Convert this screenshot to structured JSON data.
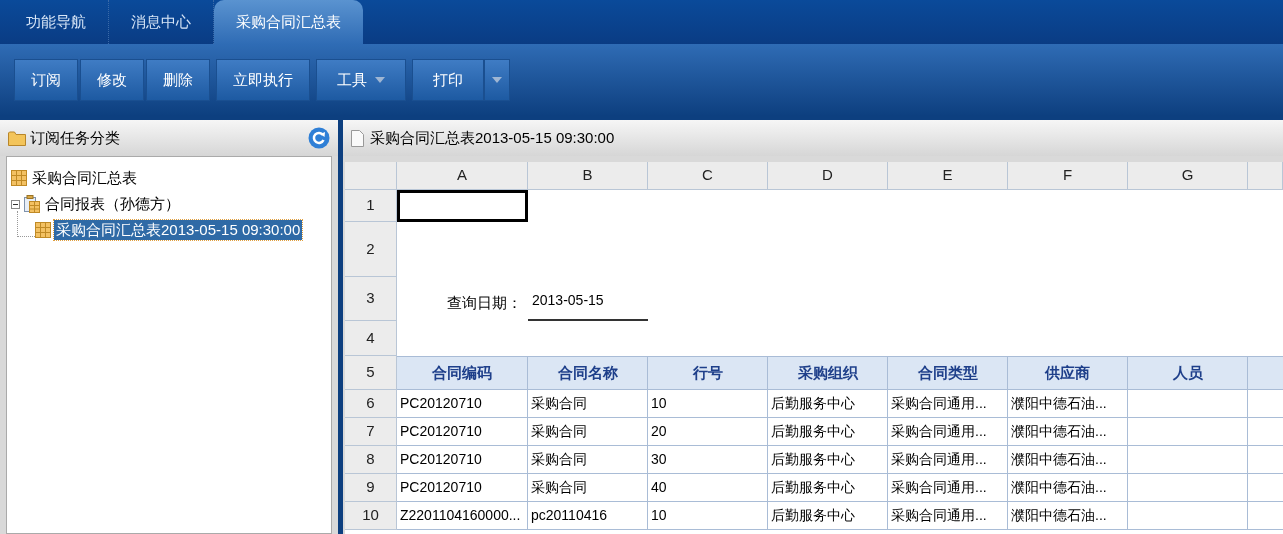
{
  "tabs": [
    {
      "label": "功能导航",
      "selected": false
    },
    {
      "label": "消息中心",
      "selected": false
    },
    {
      "label": "采购合同汇总表",
      "selected": true
    }
  ],
  "toolbar_groups": [
    {
      "buttons": [
        {
          "label": "订阅",
          "kind": "plain"
        },
        {
          "label": "修改",
          "kind": "plain"
        },
        {
          "label": "删除",
          "kind": "plain"
        }
      ]
    },
    {
      "buttons": [
        {
          "label": "立即执行",
          "kind": "plain"
        }
      ]
    },
    {
      "buttons": [
        {
          "label": "工具",
          "kind": "menu"
        }
      ]
    },
    {
      "buttons": [
        {
          "label": "打印",
          "kind": "split"
        }
      ]
    }
  ],
  "left_panel": {
    "title": "订阅任务分类",
    "tree": [
      {
        "label": "采购合同汇总表",
        "kind": "report",
        "selected": false
      },
      {
        "label": "合同报表（孙德方）",
        "kind": "folder",
        "selected": false,
        "expanded": true,
        "children": [
          {
            "label": "采购合同汇总表2013-05-15 09:30:00",
            "kind": "report",
            "selected": true
          }
        ]
      }
    ]
  },
  "sheet": {
    "title": "采购合同汇总表2013-05-15 09:30:00",
    "column_letters": [
      "A",
      "B",
      "C",
      "D",
      "E",
      "F",
      "G"
    ],
    "row_numbers": [
      "1",
      "2",
      "3",
      "4",
      "5",
      "6",
      "7",
      "8",
      "9",
      "10"
    ],
    "cursor_in_first_cell": true,
    "query": {
      "label": "查询日期：",
      "value": "2013-05-15"
    },
    "table": {
      "columns": [
        "合同编码",
        "合同名称",
        "行号",
        "采购组织",
        "合同类型",
        "供应商",
        "人员"
      ],
      "rows": [
        [
          "PC20120710",
          "采购合同",
          "10",
          "后勤服务中心",
          "采购合同通用...",
          "濮阳中德石油..."
        ],
        [
          "PC20120710",
          "采购合同",
          "20",
          "后勤服务中心",
          "采购合同通用...",
          "濮阳中德石油..."
        ],
        [
          "PC20120710",
          "采购合同",
          "30",
          "后勤服务中心",
          "采购合同通用...",
          "濮阳中德石油..."
        ],
        [
          "PC20120710",
          "采购合同",
          "40",
          "后勤服务中心",
          "采购合同通用...",
          "濮阳中德石油..."
        ],
        [
          "Z2201104160000...",
          "pc20110416",
          "10",
          "后勤服务中心",
          "采购合同通用...",
          "濮阳中德石油..."
        ]
      ]
    }
  }
}
